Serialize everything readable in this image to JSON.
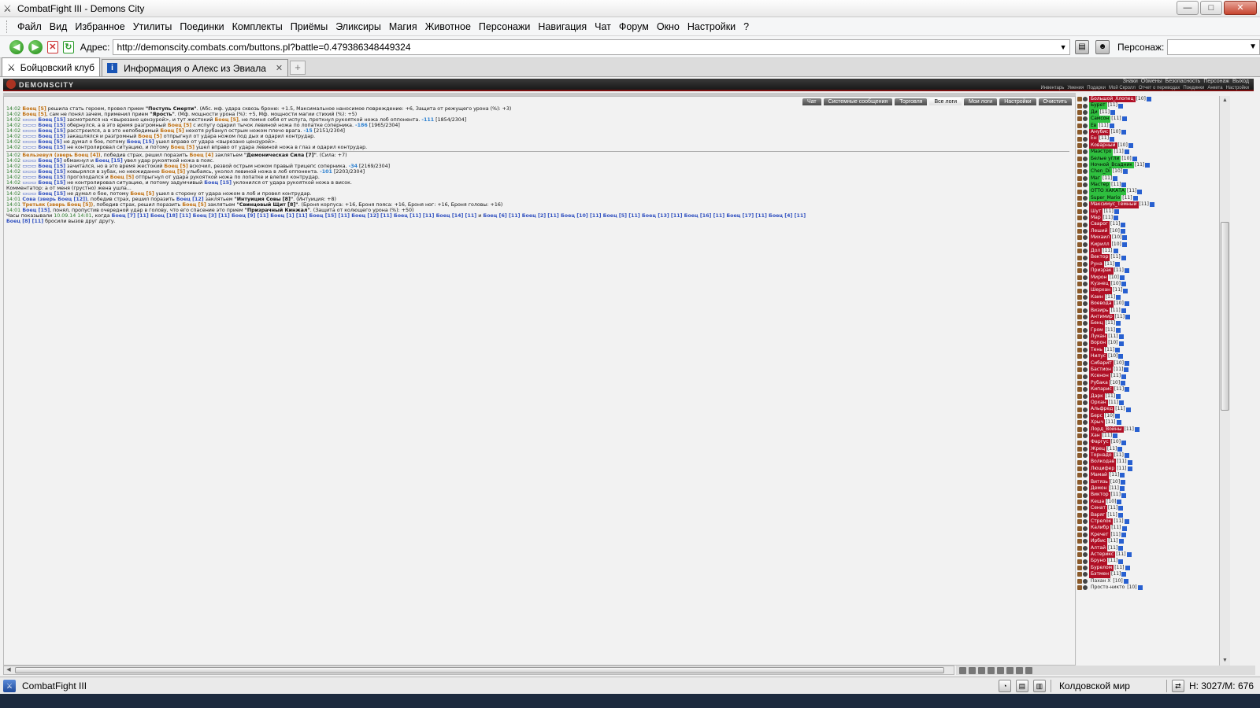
{
  "window": {
    "title": "CombatFight III - Demons City",
    "buttons": {
      "minimize": "—",
      "maximize": "□",
      "close": "✕"
    }
  },
  "menu": {
    "items": [
      "Файл",
      "Вид",
      "Избранное",
      "Утилиты",
      "Поединки",
      "Комплекты",
      "Приёмы",
      "Эликсиры",
      "Магия",
      "Животное",
      "Персонажи",
      "Навигация",
      "Чат",
      "Форум",
      "Окно",
      "Настройки",
      "?"
    ]
  },
  "address": {
    "label": "Адрес:",
    "url": "http://demonscity.combats.com/buttons.pl?battle=0.479386348449324",
    "character_label": "Персонаж:"
  },
  "tabs": [
    {
      "label": "Бойцовский клуб",
      "active": true
    },
    {
      "label": "Информация о Алекс из Эвиала",
      "active": false
    }
  ],
  "game": {
    "logo": "DEMONSCITY",
    "nav_top": [
      "Знаки",
      "Обмены",
      "Безопасность",
      "Персонаж",
      "Выход"
    ],
    "nav_bottom": [
      "Инвентарь",
      "Умения",
      "Подарки",
      "Мой Скролл",
      "Отчет о переводах",
      "Поединки",
      "Анкета",
      "Настройки"
    ],
    "chat_tabs": [
      "Чат",
      "Системные сообщения",
      "Торговля",
      "Все логи",
      "Мои логи",
      "Настройки",
      "Очистить"
    ],
    "active_chat_tab": "Все логи"
  },
  "log": [
    {
      "parts": [
        [
          "ts",
          "14:02"
        ],
        [
          "o",
          " Боец [5]"
        ],
        [
          "",
          "  решила стать героем, провел прием "
        ],
        [
          "strong",
          "\"Поступь Смерти\""
        ],
        [
          "",
          ". (Абс. мф. удара сквозь броню: +1.5, Максимальное наносимое повреждение: +6, Защита от режущего урона (%): +3)"
        ]
      ]
    },
    {
      "parts": [
        [
          "ts",
          "14:02"
        ],
        [
          "o",
          " Боец [5]"
        ],
        [
          "",
          ", сам не понял зачем, применил прием "
        ],
        [
          "strong",
          "\"Ярость\""
        ],
        [
          "",
          ". (Мф. мощности урона (%): +5, Мф. мощности магии стихий (%): +5)"
        ]
      ]
    },
    {
      "parts": [
        [
          "ts",
          "14:02"
        ],
        [
          "b",
          " ▭▭▭ Боец [15]"
        ],
        [
          "",
          "  засмотрелся на <вырезано цензурой>, и тут жестокий "
        ],
        [
          "o",
          "Боец [5]"
        ],
        [
          "",
          ", не помня себя от испуга, проткнул рукояткой ножа лоб оппонента. "
        ],
        [
          "dmg",
          "-111"
        ],
        [
          "",
          " [1854/2304]"
        ]
      ]
    },
    {
      "parts": [
        [
          "ts",
          "14:02"
        ],
        [
          "b",
          " ▭▭▭ Боец [15]"
        ],
        [
          "",
          "  обернулся, а в это время разгромный "
        ],
        [
          "o",
          "Боец [5]"
        ],
        [
          "",
          " с испугу одарил тычок левиной ножа по лопатке соперника. "
        ],
        [
          "dmg",
          "-186"
        ],
        [
          "",
          " [1965/2304]"
        ]
      ]
    },
    {
      "parts": [
        [
          "ts",
          "14:02"
        ],
        [
          "b",
          " ▭▭▭ Боец [15]"
        ],
        [
          "",
          "  расстроился, а в это непобедимый "
        ],
        [
          "o",
          "Боец [5]"
        ],
        [
          "",
          " нехотя рубанул острым ножом плечо врага. "
        ],
        [
          "dmg",
          "-15"
        ],
        [
          "",
          " [2151/2304]"
        ]
      ]
    },
    {
      "parts": [
        [
          "ts",
          "14:02"
        ],
        [
          "b",
          " ▭▭▭ Боец [15]"
        ],
        [
          "",
          "  закашлялся и разгромный "
        ],
        [
          "o",
          "Боец [5]"
        ],
        [
          "",
          " отпрыгнул от удара ножом под дых и одарил контрудар."
        ]
      ]
    },
    {
      "parts": [
        [
          "ts",
          "14:02"
        ],
        [
          "b",
          " ▭▭▭ Боец [5]"
        ],
        [
          "",
          "  не думал о бое, потому "
        ],
        [
          "b",
          "Боец [15]"
        ],
        [
          "",
          " ушел вправо от удара <вырезано цензурой>."
        ]
      ]
    },
    {
      "parts": [
        [
          "ts",
          "14:02"
        ],
        [
          "b",
          " ▭▭▭ Боец [15]"
        ],
        [
          "",
          "  не контролировал ситуацию, и потому "
        ],
        [
          "o",
          "Боец [5]"
        ],
        [
          "",
          " ушел вправо от удара левиной ножа в глаз и одарил контрудар."
        ]
      ]
    },
    {
      "parts": [
        [
          "ts",
          "14:02"
        ],
        [
          "o",
          " Бельзевул (зверь Боец [4])"
        ],
        [
          "",
          ", победив страх, решил поразить "
        ],
        [
          "o",
          "Боец [4]"
        ],
        [
          "",
          "  заклятьем "
        ],
        [
          "strong",
          "\"Демоническая Сила [7]\""
        ],
        [
          "",
          ". (Сила: +7)"
        ]
      ],
      "sep": true
    },
    {
      "parts": [
        [
          "ts",
          "14:02"
        ],
        [
          "b",
          " ▭▭▭ Боец [5]"
        ],
        [
          "",
          "  обмакнул и "
        ],
        [
          "b",
          "Боец [15]"
        ],
        [
          "",
          " увел удар рукояткой ножа в пояс."
        ]
      ]
    },
    {
      "parts": [
        [
          "ts",
          "14:02"
        ],
        [
          "b",
          " ▭▭▭ Боец [15]"
        ],
        [
          "",
          "  зачитался, но в это время жестокий "
        ],
        [
          "o",
          "Боец [5]"
        ],
        [
          "",
          "  вскочил, резвой острым ножом правый трицепс соперника. "
        ],
        [
          "dmg",
          "-34"
        ],
        [
          "",
          " [2169/2304]"
        ]
      ]
    },
    {
      "parts": [
        [
          "ts",
          "14:02"
        ],
        [
          "b",
          " ▭▭▭ Боец [15]"
        ],
        [
          "",
          "  ковырялся в зубах, но неожиданно "
        ],
        [
          "o",
          "Боец [5]"
        ],
        [
          "",
          "  улыбаясь, уколол левиной ножа в лоб оппонента. "
        ],
        [
          "dmg",
          "-101"
        ],
        [
          "",
          " [2203/2304]"
        ]
      ]
    },
    {
      "parts": [
        [
          "ts",
          "14:02"
        ],
        [
          "b",
          " ▭▭▭ Боец [15]"
        ],
        [
          "",
          "  проголодался и "
        ],
        [
          "o",
          "Боец [5]"
        ],
        [
          "",
          " отпрыгнул от удара рукояткой ножа по лопатке и влепил контрудар."
        ]
      ]
    },
    {
      "parts": [
        [
          "ts",
          "14:02"
        ],
        [
          "b",
          " ▭▭▭ Боец [15]"
        ],
        [
          "",
          "  не контролировал ситуацию, и потому задумчивый "
        ],
        [
          "b",
          "Боец [15]"
        ],
        [
          "",
          " уклонился от удара рукояткой ножа в висок."
        ]
      ]
    },
    {
      "parts": [
        [
          "",
          "Комментатор: а от меня (грустно) жена ушла..."
        ]
      ]
    },
    {
      "parts": [
        [
          "ts",
          "14:02"
        ],
        [
          "b",
          " ▭▭▭ Боец [15]"
        ],
        [
          "",
          "  не думал о бое, потому "
        ],
        [
          "o",
          "Боец [5]"
        ],
        [
          "",
          " ушел в сторону от удара ножом в лоб и провел контрудар."
        ]
      ]
    },
    {
      "parts": [
        [
          "ts",
          "14:01"
        ],
        [
          "b",
          " Сова (зверь Боец [12])"
        ],
        [
          "",
          ", победив страх, решил поразить "
        ],
        [
          "b",
          "Боец [12]"
        ],
        [
          "",
          "  заклятьем "
        ],
        [
          "strong",
          "\"Интуиция Совы [8]\""
        ],
        [
          "",
          ". (Интуиция: +8)"
        ]
      ]
    },
    {
      "parts": [
        [
          "ts",
          "14:01"
        ],
        [
          "o",
          " Третьяк (зверь Боец [5])"
        ],
        [
          "",
          ", победив страх, решил поразить "
        ],
        [
          "o",
          "Боец [5]"
        ],
        [
          "",
          "  заклятьем "
        ],
        [
          "strong",
          "\"Свинцовый Щит [8]\""
        ],
        [
          "",
          ". (Броня корпуса: +16, Броня пояса: +16, Броня ног: +16, Броня головы: +16)"
        ]
      ]
    },
    {
      "parts": [
        [
          "ts",
          "14:01"
        ],
        [
          "b",
          " Боец [15]"
        ],
        [
          "",
          ", понял, пропустив очередной удар в голову, что его спасение это прием "
        ],
        [
          "strong",
          "\"Призрачный Кинжал\""
        ],
        [
          "",
          ". (Защита от колющего урона (%): +50)"
        ]
      ]
    },
    {
      "parts": [
        [
          "",
          "Часы показывали "
        ],
        [
          "ts",
          "10.09.14 14:01"
        ],
        [
          "",
          ", когда "
        ],
        [
          "b",
          "Боец [7] [11] "
        ],
        [
          "b",
          "Боец [18] [11] "
        ],
        [
          "b",
          "Боец [3] [11] "
        ],
        [
          "b",
          "Боец [9] [11] "
        ],
        [
          "b",
          "Боец [1] [11] "
        ],
        [
          "b",
          "Боец [15] [11] "
        ],
        [
          "b",
          "Боец [12] [11] "
        ],
        [
          "b",
          "Боец [11] [11] "
        ],
        [
          "b",
          "Боец [14] [11] "
        ],
        [
          "",
          "и "
        ],
        [
          "b",
          "Боец [6] [11] "
        ],
        [
          "b",
          "Боец [2] [11] "
        ],
        [
          "b",
          "Боец [10] [11] "
        ],
        [
          "b",
          "Боец [5] [11] "
        ],
        [
          "b",
          "Боец [13] [11] "
        ],
        [
          "b",
          "Боец [16] [11] "
        ],
        [
          "b",
          "Боец [17] [11] "
        ],
        [
          "b",
          "Боец [4] [11]"
        ]
      ]
    },
    {
      "parts": [
        [
          "b",
          "Боец [8] [11]"
        ],
        [
          "",
          ""
        ],
        [
          "",
          "  бросили вызов друг другу."
        ]
      ]
    }
  ],
  "users": [
    [
      "Большой_Хлопец",
      "red",
      "[10]"
    ],
    [
      "Бурет",
      "green",
      "[11]"
    ],
    [
      "Ди",
      "green",
      "[11]"
    ],
    [
      "Самсон",
      "green",
      "[11]"
    ],
    [
      "Ев",
      "green",
      "[11]"
    ],
    [
      "Анубис",
      "red",
      "[10]"
    ],
    [
      "Ен",
      "red",
      "[11]"
    ],
    [
      "Коварный",
      "red",
      "[10]"
    ],
    [
      "Маэстро",
      "green",
      "[11]"
    ],
    [
      "Белые угли",
      "green",
      "[10]"
    ],
    [
      "Ночной_Всадник",
      "green",
      "[11]"
    ],
    [
      "Chen_Di",
      "green",
      "[10]"
    ],
    [
      "Маг",
      "green",
      "[11]"
    ],
    [
      "Мастер",
      "green",
      "[11]"
    ],
    [
      "ОТТО ХАКАТА",
      "green",
      "[11]"
    ],
    [
      "Super_Mario",
      "green",
      "[11]"
    ],
    [
      "Максимус_Темный",
      "red",
      "[11]"
    ],
    [
      "Шут",
      "red",
      "[11]"
    ],
    [
      "Мар",
      "red",
      "[11]"
    ],
    [
      "Сварог",
      "red",
      "[11]"
    ],
    [
      "Леший",
      "red",
      "[10]"
    ],
    [
      "Михаил",
      "red",
      "[10]"
    ],
    [
      "Кирилл",
      "red",
      "[10]"
    ],
    [
      "Дол",
      "red",
      "[11]"
    ],
    [
      "Вектор",
      "red",
      "[11]"
    ],
    [
      "Руна",
      "red",
      "[11]"
    ],
    [
      "Призрак",
      "red",
      "[11]"
    ],
    [
      "Мирон",
      "red",
      "[10]"
    ],
    [
      "Кузнец",
      "red",
      "[10]"
    ],
    [
      "Шерхан",
      "red",
      "[11]"
    ],
    [
      "Каин",
      "red",
      "[11]"
    ],
    [
      "Воевода",
      "red",
      "[10]"
    ],
    [
      "Визирь",
      "red",
      "[11]"
    ],
    [
      "Антимир",
      "red",
      "[11]"
    ],
    [
      "Бенц",
      "red",
      "[11]"
    ],
    [
      "Гром",
      "red",
      "[11]"
    ],
    [
      "Лукан",
      "red",
      "[11]"
    ],
    [
      "Ворон",
      "red",
      "[10]"
    ],
    [
      "Тень",
      "red",
      "[11]"
    ],
    [
      "Нилус",
      "red",
      "[10]"
    ],
    [
      "Сибарит",
      "red",
      "[10]"
    ],
    [
      "Бастион",
      "red",
      "[11]"
    ],
    [
      "Ксенон",
      "red",
      "[11]"
    ],
    [
      "Рубака",
      "red",
      "[10]"
    ],
    [
      "Кипарис",
      "red",
      "[11]"
    ],
    [
      "Дарк",
      "red",
      "[11]"
    ],
    [
      "Орхан",
      "red",
      "[11]"
    ],
    [
      "Альфред",
      "red",
      "[11]"
    ],
    [
      "Берс",
      "red",
      "[10]"
    ],
    [
      "Хрыч",
      "red",
      "[11]"
    ],
    [
      "Лорд_Войны",
      "red",
      "[11]"
    ],
    [
      "Хан",
      "red",
      "[11]"
    ],
    [
      "Фаргус",
      "red",
      "[10]"
    ],
    [
      "Жрец",
      "red",
      "[11]"
    ],
    [
      "Торнадо",
      "red",
      "[11]"
    ],
    [
      "Волкодав",
      "red",
      "[11]"
    ],
    [
      "Люцифер",
      "red",
      "[11]"
    ],
    [
      "Мамай",
      "red",
      "[11]"
    ],
    [
      "Витязь",
      "red",
      "[10]"
    ],
    [
      "Демон",
      "red",
      "[11]"
    ],
    [
      "Виктор",
      "red",
      "[11]"
    ],
    [
      "Кеша",
      "red",
      "[10]"
    ],
    [
      "Сенат",
      "red",
      "[11]"
    ],
    [
      "Варяг",
      "red",
      "[11]"
    ],
    [
      "Стрелок",
      "red",
      "[11]"
    ],
    [
      "Калибр",
      "red",
      "[11]"
    ],
    [
      "Кречет",
      "red",
      "[11]"
    ],
    [
      "Ирбис",
      "red",
      "[11]"
    ],
    [
      "Алтай",
      "red",
      "[11]"
    ],
    [
      "Астерикс",
      "red",
      "[11]"
    ],
    [
      "Бруно",
      "red",
      "[11]"
    ],
    [
      "Бурелом",
      "red",
      "[11]"
    ],
    [
      "Бэтмен",
      "red",
      "[11]"
    ],
    [
      "Пахан X",
      "plain",
      "[10]"
    ],
    [
      "Просто-никто",
      "plain",
      "[10]"
    ]
  ],
  "status": {
    "app_name": "CombatFight III",
    "world": "Колдовской мир",
    "hp": "H: 3027/M: 676"
  }
}
